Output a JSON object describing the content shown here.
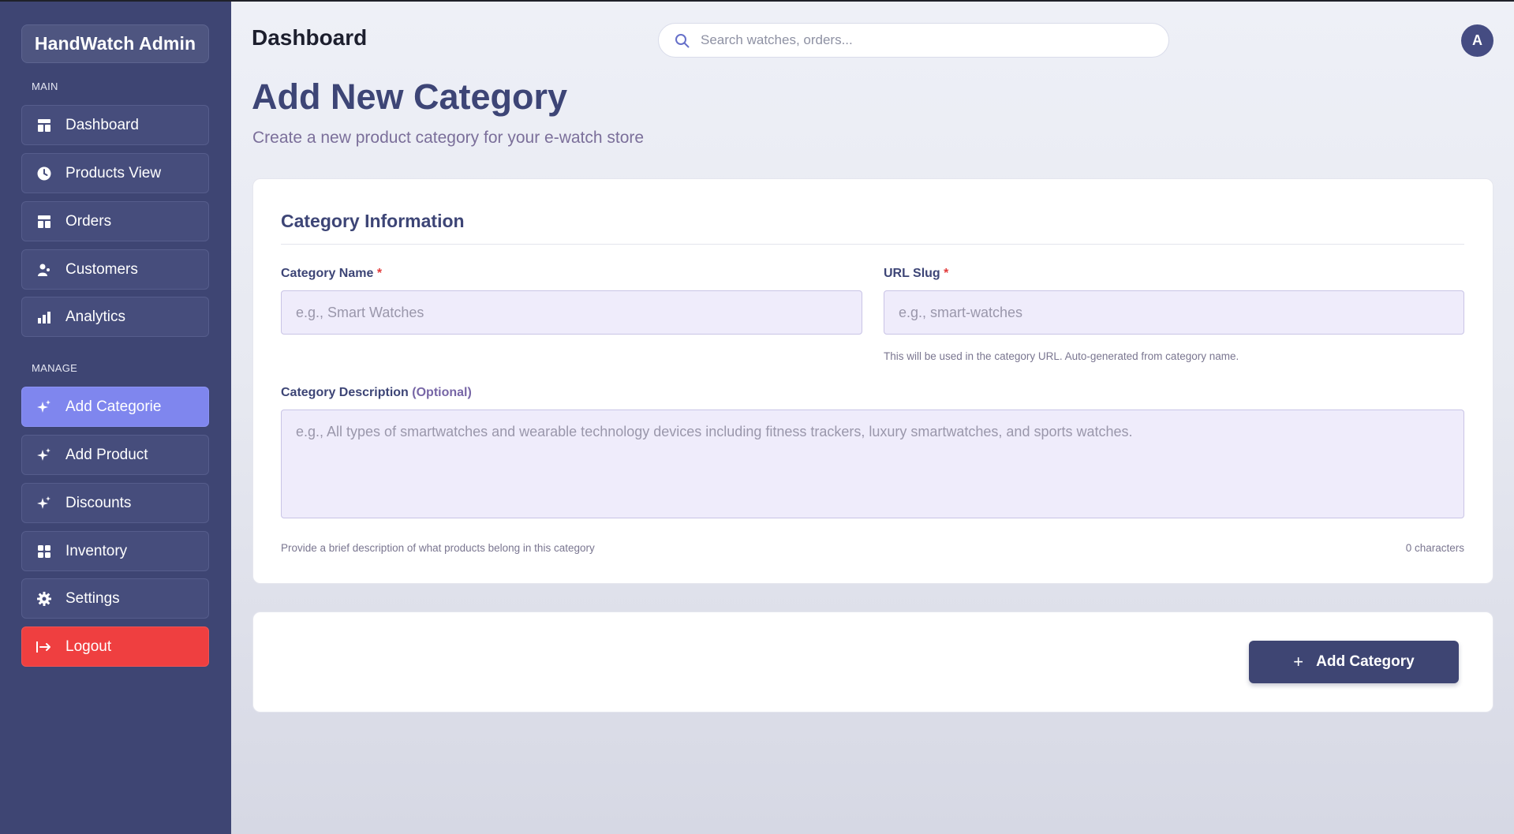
{
  "sidebar": {
    "brand": "HandWatch Admin",
    "section_main": "MAIN",
    "section_manage": "MANAGE",
    "main_items": [
      {
        "label": "Dashboard",
        "icon": "dashboard-icon"
      },
      {
        "label": "Products View",
        "icon": "clock-icon"
      },
      {
        "label": "Orders",
        "icon": "dashboard-icon"
      },
      {
        "label": "Customers",
        "icon": "user-icon"
      },
      {
        "label": "Analytics",
        "icon": "bar-chart-icon"
      }
    ],
    "manage_items": [
      {
        "label": "Add Categorie",
        "icon": "sparkle-icon",
        "active": true
      },
      {
        "label": "Add Product",
        "icon": "sparkle-icon"
      },
      {
        "label": "Discounts",
        "icon": "sparkle-icon"
      },
      {
        "label": "Inventory",
        "icon": "grid-icon"
      },
      {
        "label": "Settings",
        "icon": "gear-icon"
      }
    ],
    "logout": {
      "label": "Logout",
      "icon": "logout-icon"
    }
  },
  "header": {
    "title": "Dashboard",
    "search_placeholder": "Search watches, orders...",
    "avatar_initial": "A"
  },
  "page": {
    "title": "Add New Category",
    "subtitle": "Create a new product category for your e-watch store"
  },
  "form": {
    "section_title": "Category Information",
    "name": {
      "label": "Category Name",
      "required_mark": "*",
      "value": "",
      "placeholder": "e.g., Smart Watches"
    },
    "slug": {
      "label": "URL Slug",
      "required_mark": "*",
      "value": "",
      "placeholder": "e.g., smart-watches",
      "help": "This will be used in the category URL. Auto-generated from category name."
    },
    "description": {
      "label": "Category Description",
      "optional_label": "(Optional)",
      "value": "",
      "placeholder": "e.g., All types of smartwatches and wearable technology devices including fitness trackers, luxury smartwatches, and sports watches.",
      "help": "Provide a brief description of what products belong in this category",
      "char_count": "0 characters"
    },
    "submit": {
      "icon": "+",
      "label": "Add Category"
    }
  },
  "colors": {
    "sidebar_bg": "#3e4573",
    "active_nav": "#7f86ee",
    "logout": "#ef3f40",
    "heading": "#3d4576",
    "required": "#e23b3b",
    "input_bg": "#efecfb"
  }
}
